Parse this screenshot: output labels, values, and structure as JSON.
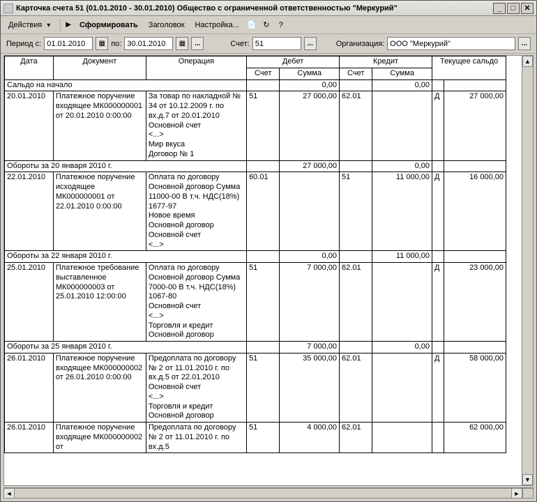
{
  "window": {
    "title": "Карточка счета 51 (01.01.2010 - 30.01.2010) Общество с ограниченной ответственностью \"Меркурий\""
  },
  "toolbar": {
    "actions": "Действия",
    "form": "Сформировать",
    "header": "Заголовок",
    "settings": "Настройка..."
  },
  "filter": {
    "period_label": "Период с:",
    "date_from": "01.01.2010",
    "date_to_label": "по:",
    "date_to": "30.01.2010",
    "account_label": "Счет:",
    "account": "51",
    "org_label": "Организация:",
    "org": "ООО \"Меркурий\""
  },
  "headers": {
    "date": "Дата",
    "document": "Документ",
    "operation": "Операция",
    "debit": "Дебет",
    "credit": "Кредит",
    "balance": "Текущее сальдо",
    "account": "Счет",
    "sum": "Сумма"
  },
  "opening": {
    "label": "Сальдо на начало",
    "debit_sum": "0,00",
    "credit_sum": "0,00"
  },
  "rows": [
    {
      "date": "20.01.2010",
      "doc": "Платежное поручение входящее МК000000001 от 20.01.2010 0:00:00",
      "op": "За товар по накладной № 34 от 10.12.2009 г. по вх.д.7 от 20.01.2010\nОсновной счет\n<...>\nМир вкуса\nДоговор № 1",
      "d_acc": "51",
      "d_sum": "27 000,00",
      "c_acc": "62.01",
      "c_sum": "",
      "bal_dc": "Д",
      "bal": "27 000,00"
    },
    {
      "subtotal": true,
      "label": "Обороты за 20 января 2010 г.",
      "d_sum": "27 000,00",
      "c_sum": "0,00"
    },
    {
      "date": "22.01.2010",
      "doc": "Платежное поручение исходящее МК000000001 от 22.01.2010 0:00:00",
      "op": "Оплата по договору Основной договор Сумма 11000-00 В т.ч. НДС(18%) 1677-97\nНовое время\nОсновной договор\nОсновной счет\n<...>",
      "d_acc": "60.01",
      "d_sum": "",
      "c_acc": "51",
      "c_sum": "11 000,00",
      "bal_dc": "Д",
      "bal": "16 000,00"
    },
    {
      "subtotal": true,
      "label": "Обороты за 22 января 2010 г.",
      "d_sum": "0,00",
      "c_sum": "11 000,00"
    },
    {
      "date": "25.01.2010",
      "doc": "Платежное требование выставленное МК000000003 от 25.01.2010 12:00:00",
      "op": "Оплата по договору Основной договор Сумма 7000-00 В т.ч. НДС(18%) 1067-80\nОсновной счет\n<...>\nТорговля и кредит\nОсновной договор",
      "d_acc": "51",
      "d_sum": "7 000,00",
      "c_acc": "62.01",
      "c_sum": "",
      "bal_dc": "Д",
      "bal": "23 000,00"
    },
    {
      "subtotal": true,
      "label": "Обороты за 25 января 2010 г.",
      "d_sum": "7 000,00",
      "c_sum": "0,00"
    },
    {
      "date": "26.01.2010",
      "doc": "Платежное поручение входящее МК000000002 от 26.01.2010 0:00:00",
      "op": "Предоплата по договору № 2 от 11.01.2010 г. по вх.д.5 от 22.01.2010\nОсновной счет\n<...>\nТорговля и кредит\nОсновной договор",
      "d_acc": "51",
      "d_sum": "35 000,00",
      "c_acc": "62.01",
      "c_sum": "",
      "bal_dc": "Д",
      "bal": "58 000,00"
    },
    {
      "date": "26.01.2010",
      "doc": "Платежное поручение входящее МК000000002 от",
      "op": "Предоплата по договору № 2 от 11.01.2010 г. по вх.д.5",
      "d_acc": "51",
      "d_sum": "4 000,00",
      "c_acc": "62.01",
      "c_sum": "",
      "bal_dc": "",
      "bal": "62 000,00"
    }
  ]
}
